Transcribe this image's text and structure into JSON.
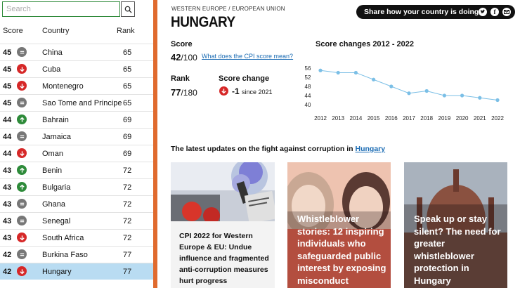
{
  "search": {
    "placeholder": "Search"
  },
  "table": {
    "headers": {
      "score": "Score",
      "country": "Country",
      "rank": "Rank"
    },
    "rows": [
      {
        "score": "45",
        "trend": "same",
        "country": "China",
        "rank": "65"
      },
      {
        "score": "45",
        "trend": "down",
        "country": "Cuba",
        "rank": "65"
      },
      {
        "score": "45",
        "trend": "down",
        "country": "Montenegro",
        "rank": "65"
      },
      {
        "score": "45",
        "trend": "same",
        "country": "Sao Tome and Principe",
        "rank": "65"
      },
      {
        "score": "44",
        "trend": "up",
        "country": "Bahrain",
        "rank": "69"
      },
      {
        "score": "44",
        "trend": "same",
        "country": "Jamaica",
        "rank": "69"
      },
      {
        "score": "44",
        "trend": "down",
        "country": "Oman",
        "rank": "69"
      },
      {
        "score": "43",
        "trend": "up",
        "country": "Benin",
        "rank": "72"
      },
      {
        "score": "43",
        "trend": "up",
        "country": "Bulgaria",
        "rank": "72"
      },
      {
        "score": "43",
        "trend": "same",
        "country": "Ghana",
        "rank": "72"
      },
      {
        "score": "43",
        "trend": "same",
        "country": "Senegal",
        "rank": "72"
      },
      {
        "score": "43",
        "trend": "down",
        "country": "South Africa",
        "rank": "72"
      },
      {
        "score": "42",
        "trend": "same",
        "country": "Burkina Faso",
        "rank": "77"
      },
      {
        "score": "42",
        "trend": "down",
        "country": "Hungary",
        "rank": "77",
        "selected": true
      }
    ]
  },
  "breadcrumb": "WESTERN EUROPE / EUROPEAN UNION",
  "country_title": "HUNGARY",
  "share": {
    "label": "Share how your country is doing",
    "icons": [
      "twitter-icon",
      "facebook-icon",
      "email-icon"
    ]
  },
  "score": {
    "label": "Score",
    "value": "42",
    "max": "/100",
    "link": "What does the CPI score mean?"
  },
  "rank": {
    "label": "Rank",
    "value": "77",
    "max": "/180"
  },
  "score_change": {
    "label": "Score change",
    "value": "-1",
    "since": "since 2021"
  },
  "chart_data": {
    "type": "line",
    "title": "Score changes 2012 - 2022",
    "x": [
      "2012",
      "2013",
      "2014",
      "2015",
      "2016",
      "2017",
      "2018",
      "2019",
      "2020",
      "2021",
      "2022"
    ],
    "series": [
      {
        "values": [
          55,
          54,
          54,
          51,
          48,
          45,
          46,
          44,
          44,
          43,
          42
        ]
      }
    ],
    "yticks": [
      40,
      44,
      48,
      52,
      56
    ],
    "ylim": [
      40,
      56
    ],
    "color": "#7bbfe6"
  },
  "updates": {
    "prefix": "The latest updates on the fight against corruption in",
    "link": "Hungary"
  },
  "cards": [
    {
      "title": "CPI 2022 for Western Europe & EU: Undue influence and fragmented anti-corruption measures hurt progress"
    },
    {
      "title": "Whistleblower stories: 12 inspiring individuals who safeguarded public interest by exposing misconduct"
    },
    {
      "title": "Speak up or stay silent? The need for greater whistleblower protection in Hungary"
    }
  ]
}
